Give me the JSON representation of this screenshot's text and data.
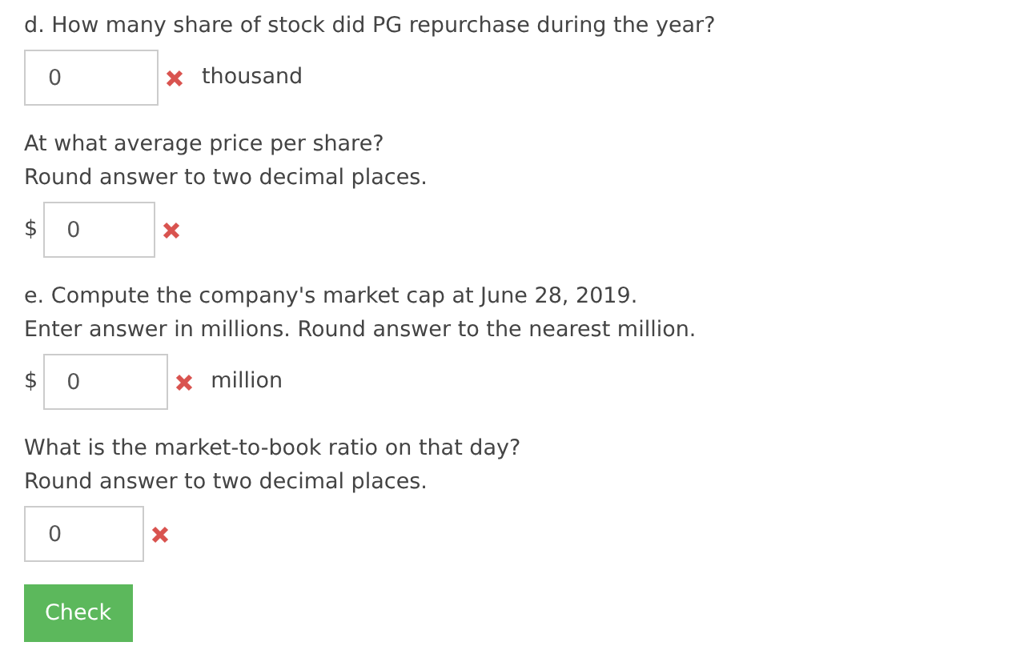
{
  "questions": [
    {
      "lines": [
        "d. How many share of stock did PG repurchase during the year?"
      ],
      "answer": {
        "value": "0",
        "correct": false,
        "suffix": "thousand"
      }
    },
    {
      "lines": [
        "At what average price per share?",
        "Round answer to two decimal places."
      ],
      "answer": {
        "prefix": "$",
        "value": "0",
        "correct": false
      }
    },
    {
      "lines": [
        "e. Compute the company's market cap at June 28, 2019.",
        "Enter answer in millions. Round answer to the nearest million."
      ],
      "answer": {
        "prefix": "$",
        "value": "0",
        "correct": false,
        "suffix": "million"
      }
    },
    {
      "lines": [
        "What is the market-to-book ratio on that day?",
        "Round answer to two decimal places."
      ],
      "answer": {
        "value": "0",
        "correct": false
      }
    }
  ],
  "check_button": "Check"
}
